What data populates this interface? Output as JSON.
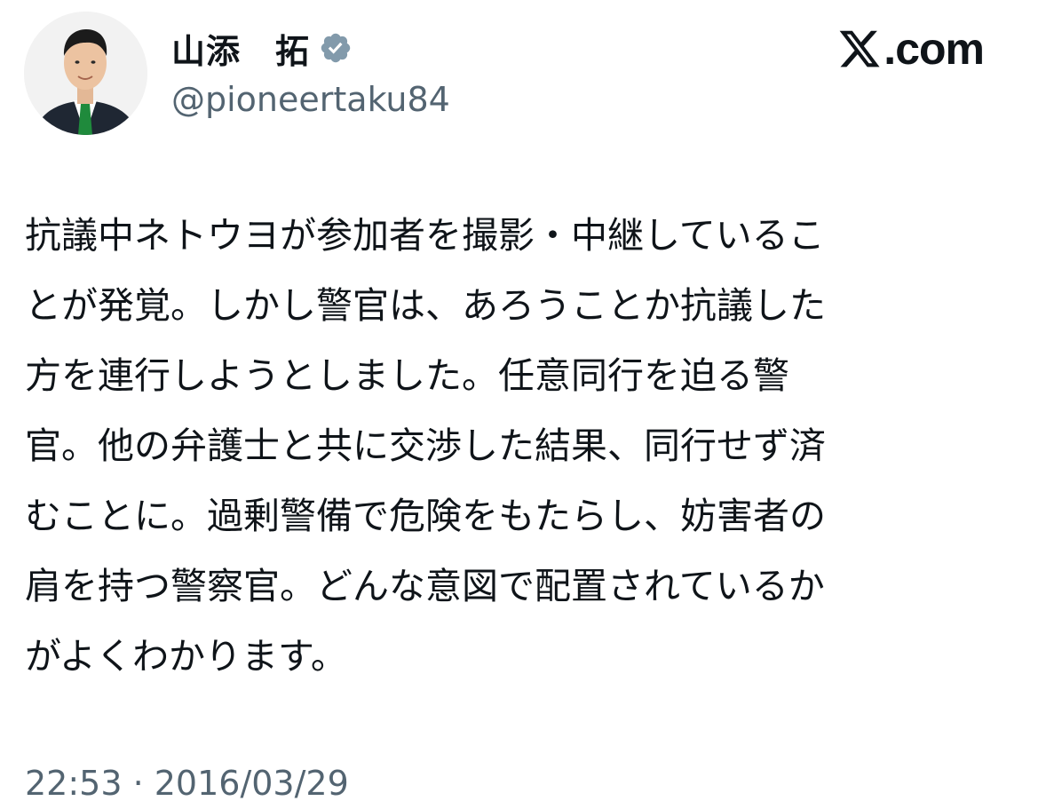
{
  "author": {
    "display_name": "山添　拓",
    "handle": "@pioneertaku84",
    "verified_icon": "verified-badge-icon",
    "avatar_icon": "profile-photo"
  },
  "brand": {
    "logo_icon": "x-logo-icon",
    "text": ".com"
  },
  "tweet": {
    "lines": [
      "抗議中ネトウヨが参加者を撮影・中継しているこ",
      "とが発覚。しかし警官は、あろうことか抗議した",
      "方を連行しようとしました。任意同行を迫る警",
      "官。他の弁護士と共に交渉した結果、同行せず済",
      "むことに。過剰警備で危険をもたらし、妨害者の",
      "肩を持つ警察官。どんな意図で配置されているか",
      "がよくわかります。"
    ],
    "timestamp": "22:53 · 2016/03/29"
  },
  "colors": {
    "text": "#0f1419",
    "secondary": "#536471",
    "verified_badge": "#829aab"
  }
}
